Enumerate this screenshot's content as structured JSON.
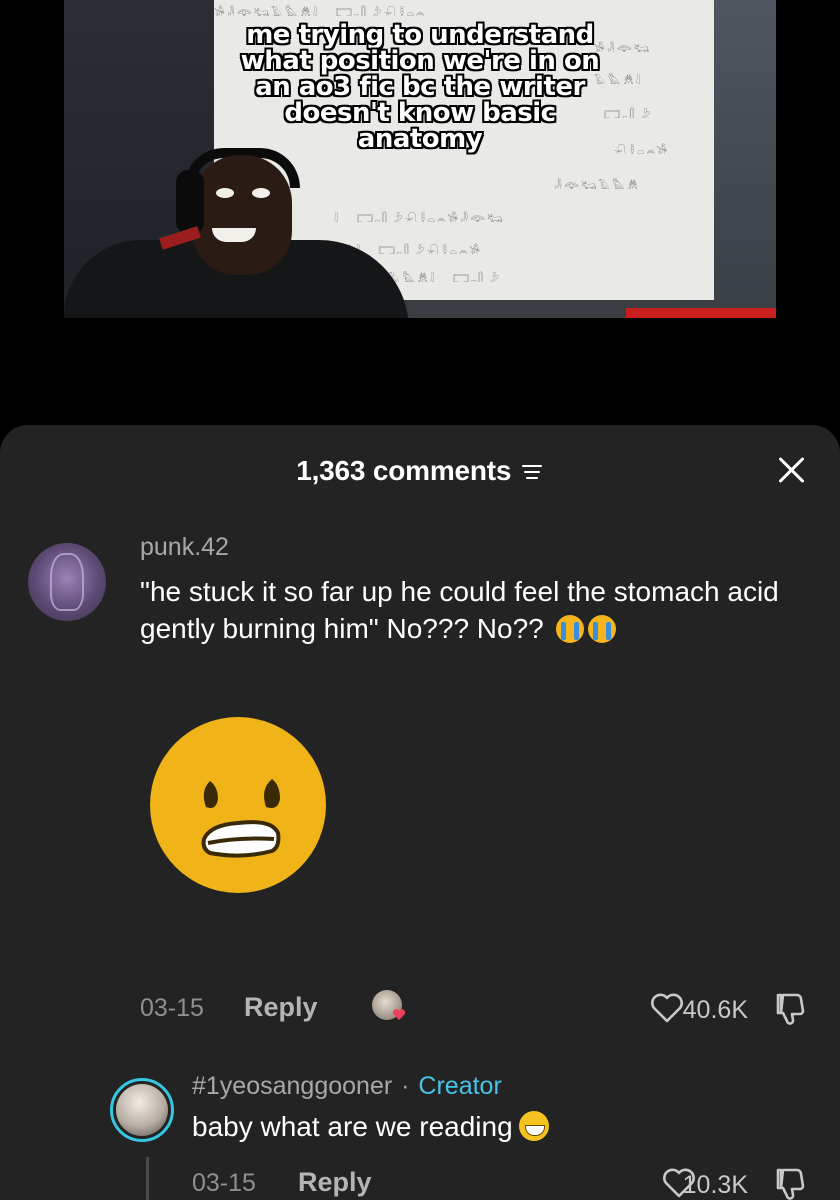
{
  "video": {
    "caption_lines": [
      "me trying to understand",
      "what position we're in on",
      "an ao3 fic bc the writer",
      "doesn't know basic",
      "anatomy"
    ]
  },
  "comments_panel": {
    "count_label": "1,363 comments",
    "filter_icon": "sort-lines-icon",
    "close_icon": "close-x-icon"
  },
  "comment": {
    "username": "punk.42",
    "text": "\"he stuck it so far up he could feel the stomach acid gently burning him\" No??? No??",
    "inline_emoji": [
      "loudly-crying-face",
      "loudly-crying-face"
    ],
    "sticker": "grimacing-face-sticker",
    "date": "03-15",
    "reply_label": "Reply",
    "likes": "40.6K",
    "creator_liked": true
  },
  "reply": {
    "username": "#1yeosanggooner",
    "separator": "·",
    "badge": "Creator",
    "text": "baby what are we reading",
    "emoji": "grinning-face",
    "date": "03-15",
    "reply_label": "Reply",
    "likes": "10.3K"
  },
  "colors": {
    "sheet_background": "#232323",
    "creator_accent": "#48c3e6",
    "muted_text": "#8f8f8f",
    "emoji_yellow": "#f3b51b"
  }
}
